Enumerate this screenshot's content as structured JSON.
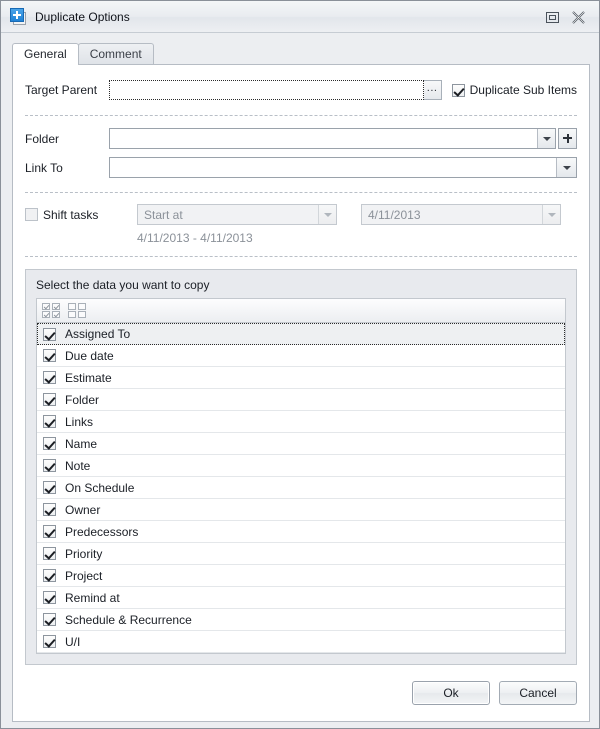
{
  "window": {
    "title": "Duplicate Options",
    "icon": "duplicate-plus-icon",
    "controls": [
      {
        "name": "restore-button",
        "icon": "restore-window-icon"
      },
      {
        "name": "close-button",
        "icon": "close-x-icon"
      }
    ]
  },
  "tabs": [
    {
      "label": "General",
      "active": true
    },
    {
      "label": "Comment",
      "active": false
    }
  ],
  "form": {
    "target_parent": {
      "label": "Target Parent",
      "value": "",
      "placeholder": "",
      "browse_label": "..."
    },
    "duplicate_sub_items": {
      "label": "Duplicate Sub Items",
      "checked": true
    },
    "folder": {
      "label": "Folder",
      "value": "",
      "placeholder": ""
    },
    "link_to": {
      "label": "Link To",
      "value": "",
      "placeholder": ""
    },
    "shift_tasks": {
      "label": "Shift tasks",
      "checked": false,
      "mode_value": "Start at",
      "date_value": "4/11/2013",
      "range_text": "4/11/2013 - 4/11/2013"
    }
  },
  "group": {
    "title": "Select the data you want to copy",
    "toolbar": [
      {
        "name": "check-all-icon",
        "label": "Check all"
      },
      {
        "name": "uncheck-all-icon",
        "label": "Uncheck all"
      }
    ],
    "items": [
      {
        "label": "Assigned To",
        "checked": true,
        "selected": true
      },
      {
        "label": "Due date",
        "checked": true,
        "selected": false
      },
      {
        "label": "Estimate",
        "checked": true,
        "selected": false
      },
      {
        "label": "Folder",
        "checked": true,
        "selected": false
      },
      {
        "label": "Links",
        "checked": true,
        "selected": false
      },
      {
        "label": "Name",
        "checked": true,
        "selected": false
      },
      {
        "label": "Note",
        "checked": true,
        "selected": false
      },
      {
        "label": "On Schedule",
        "checked": true,
        "selected": false
      },
      {
        "label": "Owner",
        "checked": true,
        "selected": false
      },
      {
        "label": "Predecessors",
        "checked": true,
        "selected": false
      },
      {
        "label": "Priority",
        "checked": true,
        "selected": false
      },
      {
        "label": "Project",
        "checked": true,
        "selected": false
      },
      {
        "label": "Remind at",
        "checked": true,
        "selected": false
      },
      {
        "label": "Schedule & Recurrence",
        "checked": true,
        "selected": false
      },
      {
        "label": "U/I",
        "checked": true,
        "selected": false
      }
    ]
  },
  "footer": {
    "ok_label": "Ok",
    "cancel_label": "Cancel"
  },
  "colors": {
    "accent": "#1f82d6",
    "window_bg": "#eceef1",
    "panel_bg": "#e8eaee",
    "text": "#1b1f26",
    "disabled_text": "#8b9199"
  }
}
